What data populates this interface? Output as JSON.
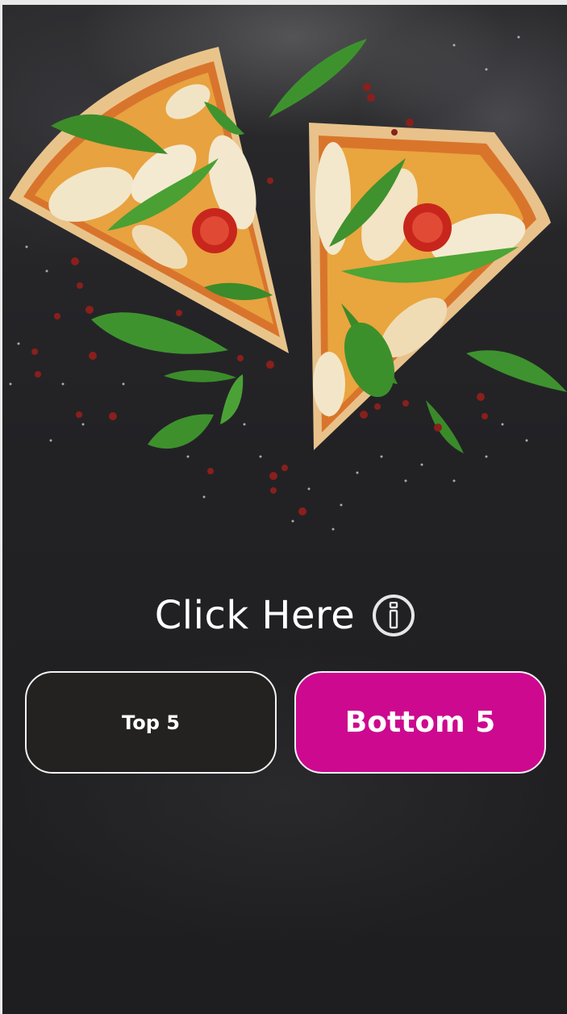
{
  "screen": {
    "cta_label": "Click Here",
    "info_icon": "info-icon",
    "buttons": {
      "top": {
        "label": "Top 5",
        "background": "#232221"
      },
      "bottom": {
        "label": "Bottom 5",
        "background": "#cc098f"
      }
    }
  },
  "colors": {
    "background": "#222225",
    "accent": "#cc098f",
    "text": "#ffffff"
  }
}
